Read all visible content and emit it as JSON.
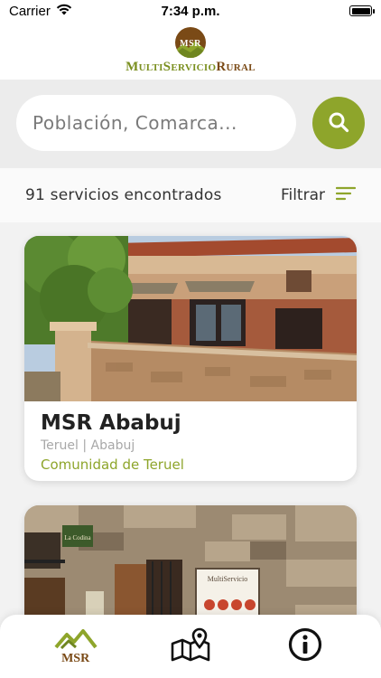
{
  "status_bar": {
    "carrier": "Carrier",
    "time": "7:34 p.m.",
    "battery_level": 1.0
  },
  "header": {
    "logo_mark_text": "MSR",
    "logo_word_1": "MultiServicio",
    "logo_word_2": "Rural"
  },
  "search": {
    "placeholder": "Población, Comarca...",
    "value": "",
    "button_icon": "search-icon"
  },
  "results": {
    "count_text": "91 servicios encontrados",
    "filter_label": "Filtrar",
    "filter_icon": "filter-lines-icon"
  },
  "services": [
    {
      "title": "MSR Ababuj",
      "location": "Teruel | Ababuj",
      "community": "Comunidad de Teruel"
    },
    {
      "sign_text": "MultiServicio",
      "sign_small_text": "La Codina"
    }
  ],
  "tab_bar": {
    "tabs": [
      {
        "label": "MSR",
        "icon": "msr-logo-icon"
      },
      {
        "label": "",
        "icon": "map-pin-icon"
      },
      {
        "label": "",
        "icon": "info-circle-icon"
      }
    ]
  },
  "colors": {
    "accent_green": "#8ea52b",
    "brand_brown": "#7a4a16",
    "brand_olive": "#7a8f1f"
  }
}
